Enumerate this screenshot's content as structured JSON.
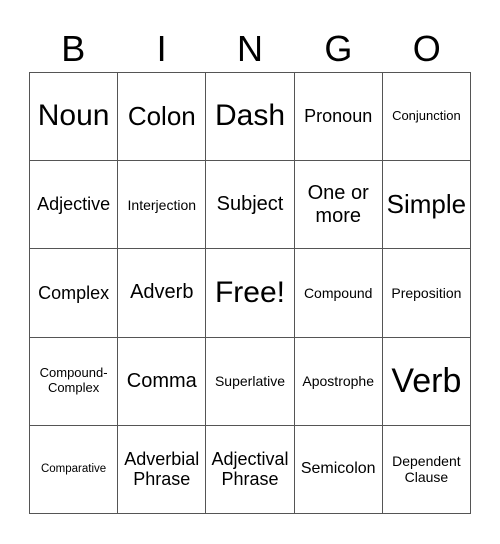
{
  "header": {
    "letters": [
      "B",
      "I",
      "N",
      "G",
      "O"
    ]
  },
  "cells": [
    {
      "text": "Noun",
      "size": "s30"
    },
    {
      "text": "Colon",
      "size": "s26"
    },
    {
      "text": "Dash",
      "size": "s30"
    },
    {
      "text": "Pronoun",
      "size": "s18"
    },
    {
      "text": "Conjunction",
      "size": "s13"
    },
    {
      "text": "Adjective",
      "size": "s18"
    },
    {
      "text": "Interjection",
      "size": "s14"
    },
    {
      "text": "Subject",
      "size": "s20"
    },
    {
      "text": "One or more",
      "size": "s20"
    },
    {
      "text": "Simple",
      "size": "s26"
    },
    {
      "text": "Complex",
      "size": "s18"
    },
    {
      "text": "Adverb",
      "size": "s20"
    },
    {
      "text": "Free!",
      "size": "s30"
    },
    {
      "text": "Compound",
      "size": "s14"
    },
    {
      "text": "Preposition",
      "size": "s14"
    },
    {
      "text": "Compound-Complex",
      "size": "s13"
    },
    {
      "text": "Comma",
      "size": "s20"
    },
    {
      "text": "Superlative",
      "size": "s14"
    },
    {
      "text": "Apostrophe",
      "size": "s14"
    },
    {
      "text": "Verb",
      "size": "s34"
    },
    {
      "text": "Comparative",
      "size": "s11"
    },
    {
      "text": "Adverbial Phrase",
      "size": "s18"
    },
    {
      "text": "Adjectival Phrase",
      "size": "s18"
    },
    {
      "text": "Semicolon",
      "size": "s16"
    },
    {
      "text": "Dependent Clause",
      "size": "s14"
    }
  ]
}
